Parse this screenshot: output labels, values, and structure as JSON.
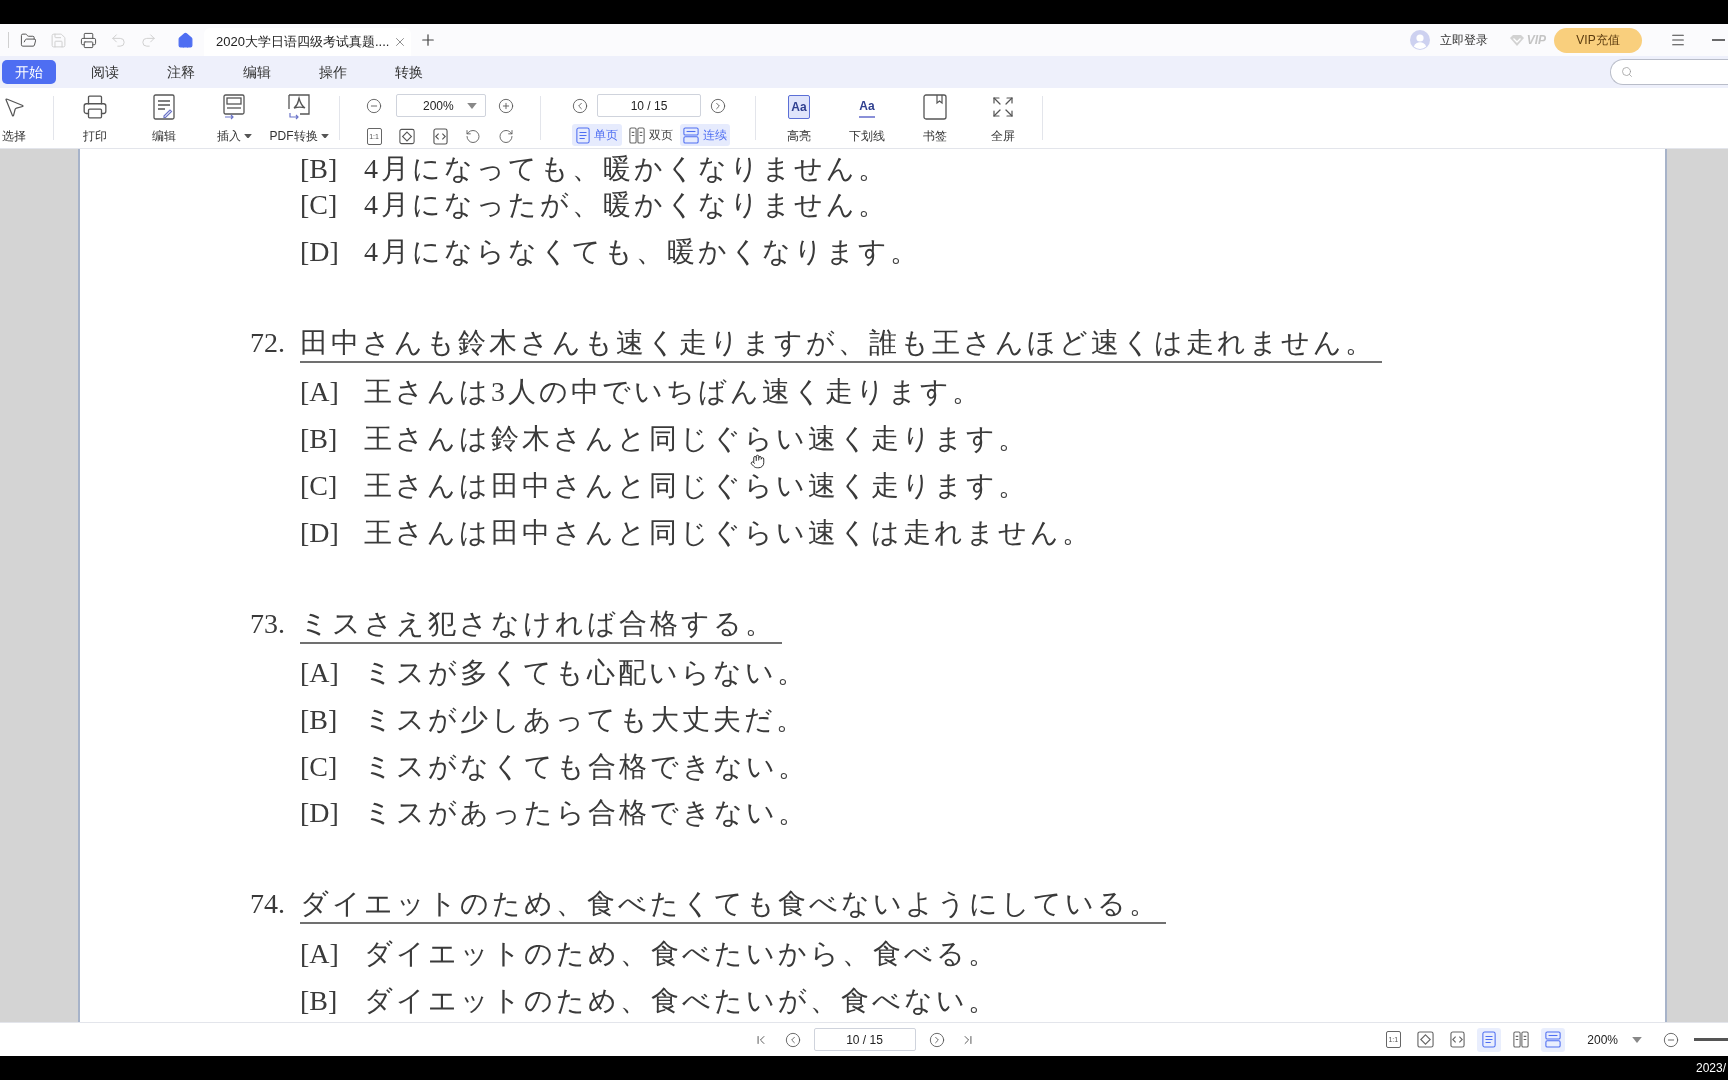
{
  "title_bar": {
    "quick_actions": [
      {
        "kind": "open",
        "disabled": false
      },
      {
        "kind": "save",
        "disabled": true
      },
      {
        "kind": "print",
        "disabled": false
      },
      {
        "kind": "undo",
        "disabled": true
      },
      {
        "kind": "redo",
        "disabled": true
      }
    ],
    "tabs": [
      {
        "title": "2020大学日语四级考试真题....",
        "selected": true
      }
    ],
    "account": {
      "login": "立即登录",
      "vip_badge": "VIP",
      "vip_button": "VIP充值"
    }
  },
  "menu_tabs": [
    {
      "label": "开始",
      "selected": true
    },
    {
      "label": "阅读",
      "selected": false
    },
    {
      "label": "注释",
      "selected": false
    },
    {
      "label": "编辑",
      "selected": false
    },
    {
      "label": "操作",
      "selected": false
    },
    {
      "label": "转换",
      "selected": false
    }
  ],
  "toolbar": {
    "tools": [
      {
        "kind": "select",
        "label": "选择",
        "dropdown": false
      },
      {
        "kind": "print",
        "label": "打印",
        "dropdown": false
      },
      {
        "kind": "edit",
        "label": "编辑",
        "dropdown": false
      },
      {
        "kind": "insert",
        "label": "插入",
        "dropdown": true
      },
      {
        "kind": "convert",
        "label": "PDF转换",
        "dropdown": true
      }
    ],
    "zoom": {
      "value": "200%",
      "actual_size_glyph": "1:1"
    },
    "page": {
      "value": "10 / 15"
    },
    "view_modes": [
      {
        "kind": "single",
        "label": "单页",
        "selected": true
      },
      {
        "kind": "double",
        "label": "双页",
        "selected": false
      },
      {
        "kind": "continuous",
        "label": "连续",
        "selected": true
      }
    ],
    "markup_tools": [
      {
        "kind": "highlight",
        "label": "高亮",
        "glyph": "Aa"
      },
      {
        "kind": "underline",
        "label": "下划线",
        "glyph": "Aa"
      },
      {
        "kind": "bookmark",
        "label": "书签"
      },
      {
        "kind": "fullscreen",
        "label": "全屏"
      }
    ]
  },
  "document": {
    "questions": [
      {
        "options": [
          {
            "letter": "[B]",
            "text": "4月になっても、暖かくなりません。"
          },
          {
            "letter": "[C]",
            "text": "4月になったが、暖かくなりません。"
          },
          {
            "letter": "[D]",
            "text": "4月にならなくても、暖かくなります。"
          }
        ]
      },
      {
        "number": "72.",
        "text": "田中さんも鈴木さんも速く走りますが、誰も王さんほど速くは走れません。",
        "options": [
          {
            "letter": "[A]",
            "text": "王さんは3人の中でいちばん速く走ります。"
          },
          {
            "letter": "[B]",
            "text": "王さんは鈴木さんと同じぐらい速く走ります。"
          },
          {
            "letter": "[C]",
            "text": "王さんは田中さんと同じぐらい速く走ります。"
          },
          {
            "letter": "[D]",
            "text": "王さんは田中さんと同じぐらい速くは走れません。"
          }
        ]
      },
      {
        "number": "73.",
        "text": "ミスさえ犯さなければ合格する。",
        "options": [
          {
            "letter": "[A]",
            "text": "ミスが多くても心配いらない。"
          },
          {
            "letter": "[B]",
            "text": "ミスが少しあっても大丈夫だ。"
          },
          {
            "letter": "[C]",
            "text": "ミスがなくても合格できない。"
          },
          {
            "letter": "[D]",
            "text": "ミスがあったら合格できない。"
          }
        ]
      },
      {
        "number": "74.",
        "text": "ダイエットのため、食べたくても食べないようにしている。",
        "options": [
          {
            "letter": "[A]",
            "text": "ダイエットのため、食べたいから、食べる。"
          },
          {
            "letter": "[B]",
            "text": "ダイエットのため、食べたいが、食べない。"
          }
        ]
      }
    ]
  },
  "status_bar": {
    "page": "10 / 15",
    "view_buttons": [
      {
        "kind": "actual_size",
        "glyph": "1:1",
        "selected": false
      },
      {
        "kind": "fit_page",
        "selected": false
      },
      {
        "kind": "fit_width",
        "selected": false
      },
      {
        "kind": "single",
        "selected": true
      },
      {
        "kind": "double",
        "selected": false
      },
      {
        "kind": "continuous",
        "selected": true
      }
    ],
    "zoom": "200%"
  },
  "taskbar": {
    "clock": "2023/"
  }
}
